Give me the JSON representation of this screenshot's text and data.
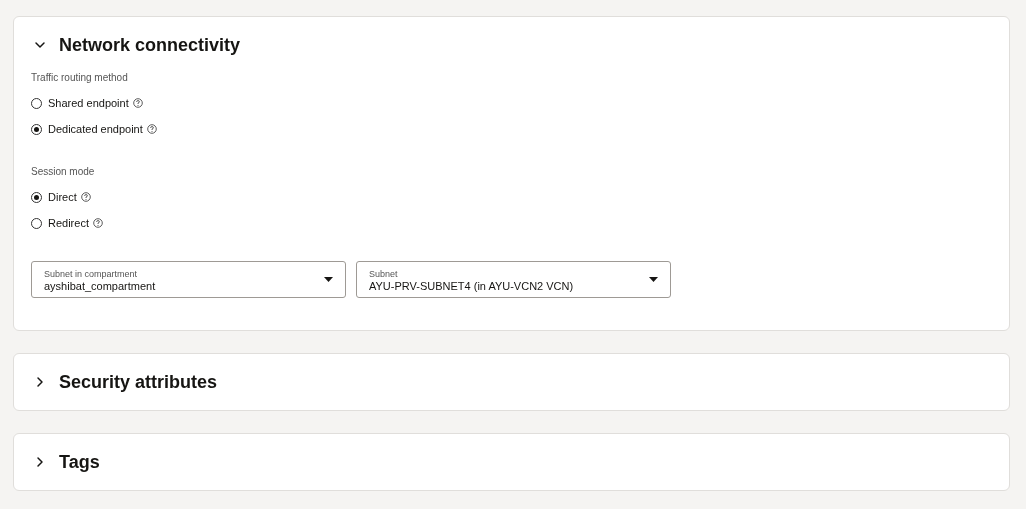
{
  "sections": [
    {
      "title": "Network connectivity",
      "expanded": true,
      "radio_groups": [
        {
          "label": "Traffic routing method",
          "options": [
            {
              "label": "Shared endpoint",
              "selected": false
            },
            {
              "label": "Dedicated endpoint",
              "selected": true
            }
          ]
        },
        {
          "label": "Session mode",
          "options": [
            {
              "label": "Direct",
              "selected": true
            },
            {
              "label": "Redirect",
              "selected": false
            }
          ]
        }
      ],
      "selects": [
        {
          "label": "Subnet in compartment",
          "value": "ayshibat_compartment"
        },
        {
          "label": "Subnet",
          "value": "AYU-PRV-SUBNET4 (in AYU-VCN2 VCN)"
        }
      ]
    },
    {
      "title": "Security attributes",
      "expanded": false
    },
    {
      "title": "Tags",
      "expanded": false
    }
  ]
}
